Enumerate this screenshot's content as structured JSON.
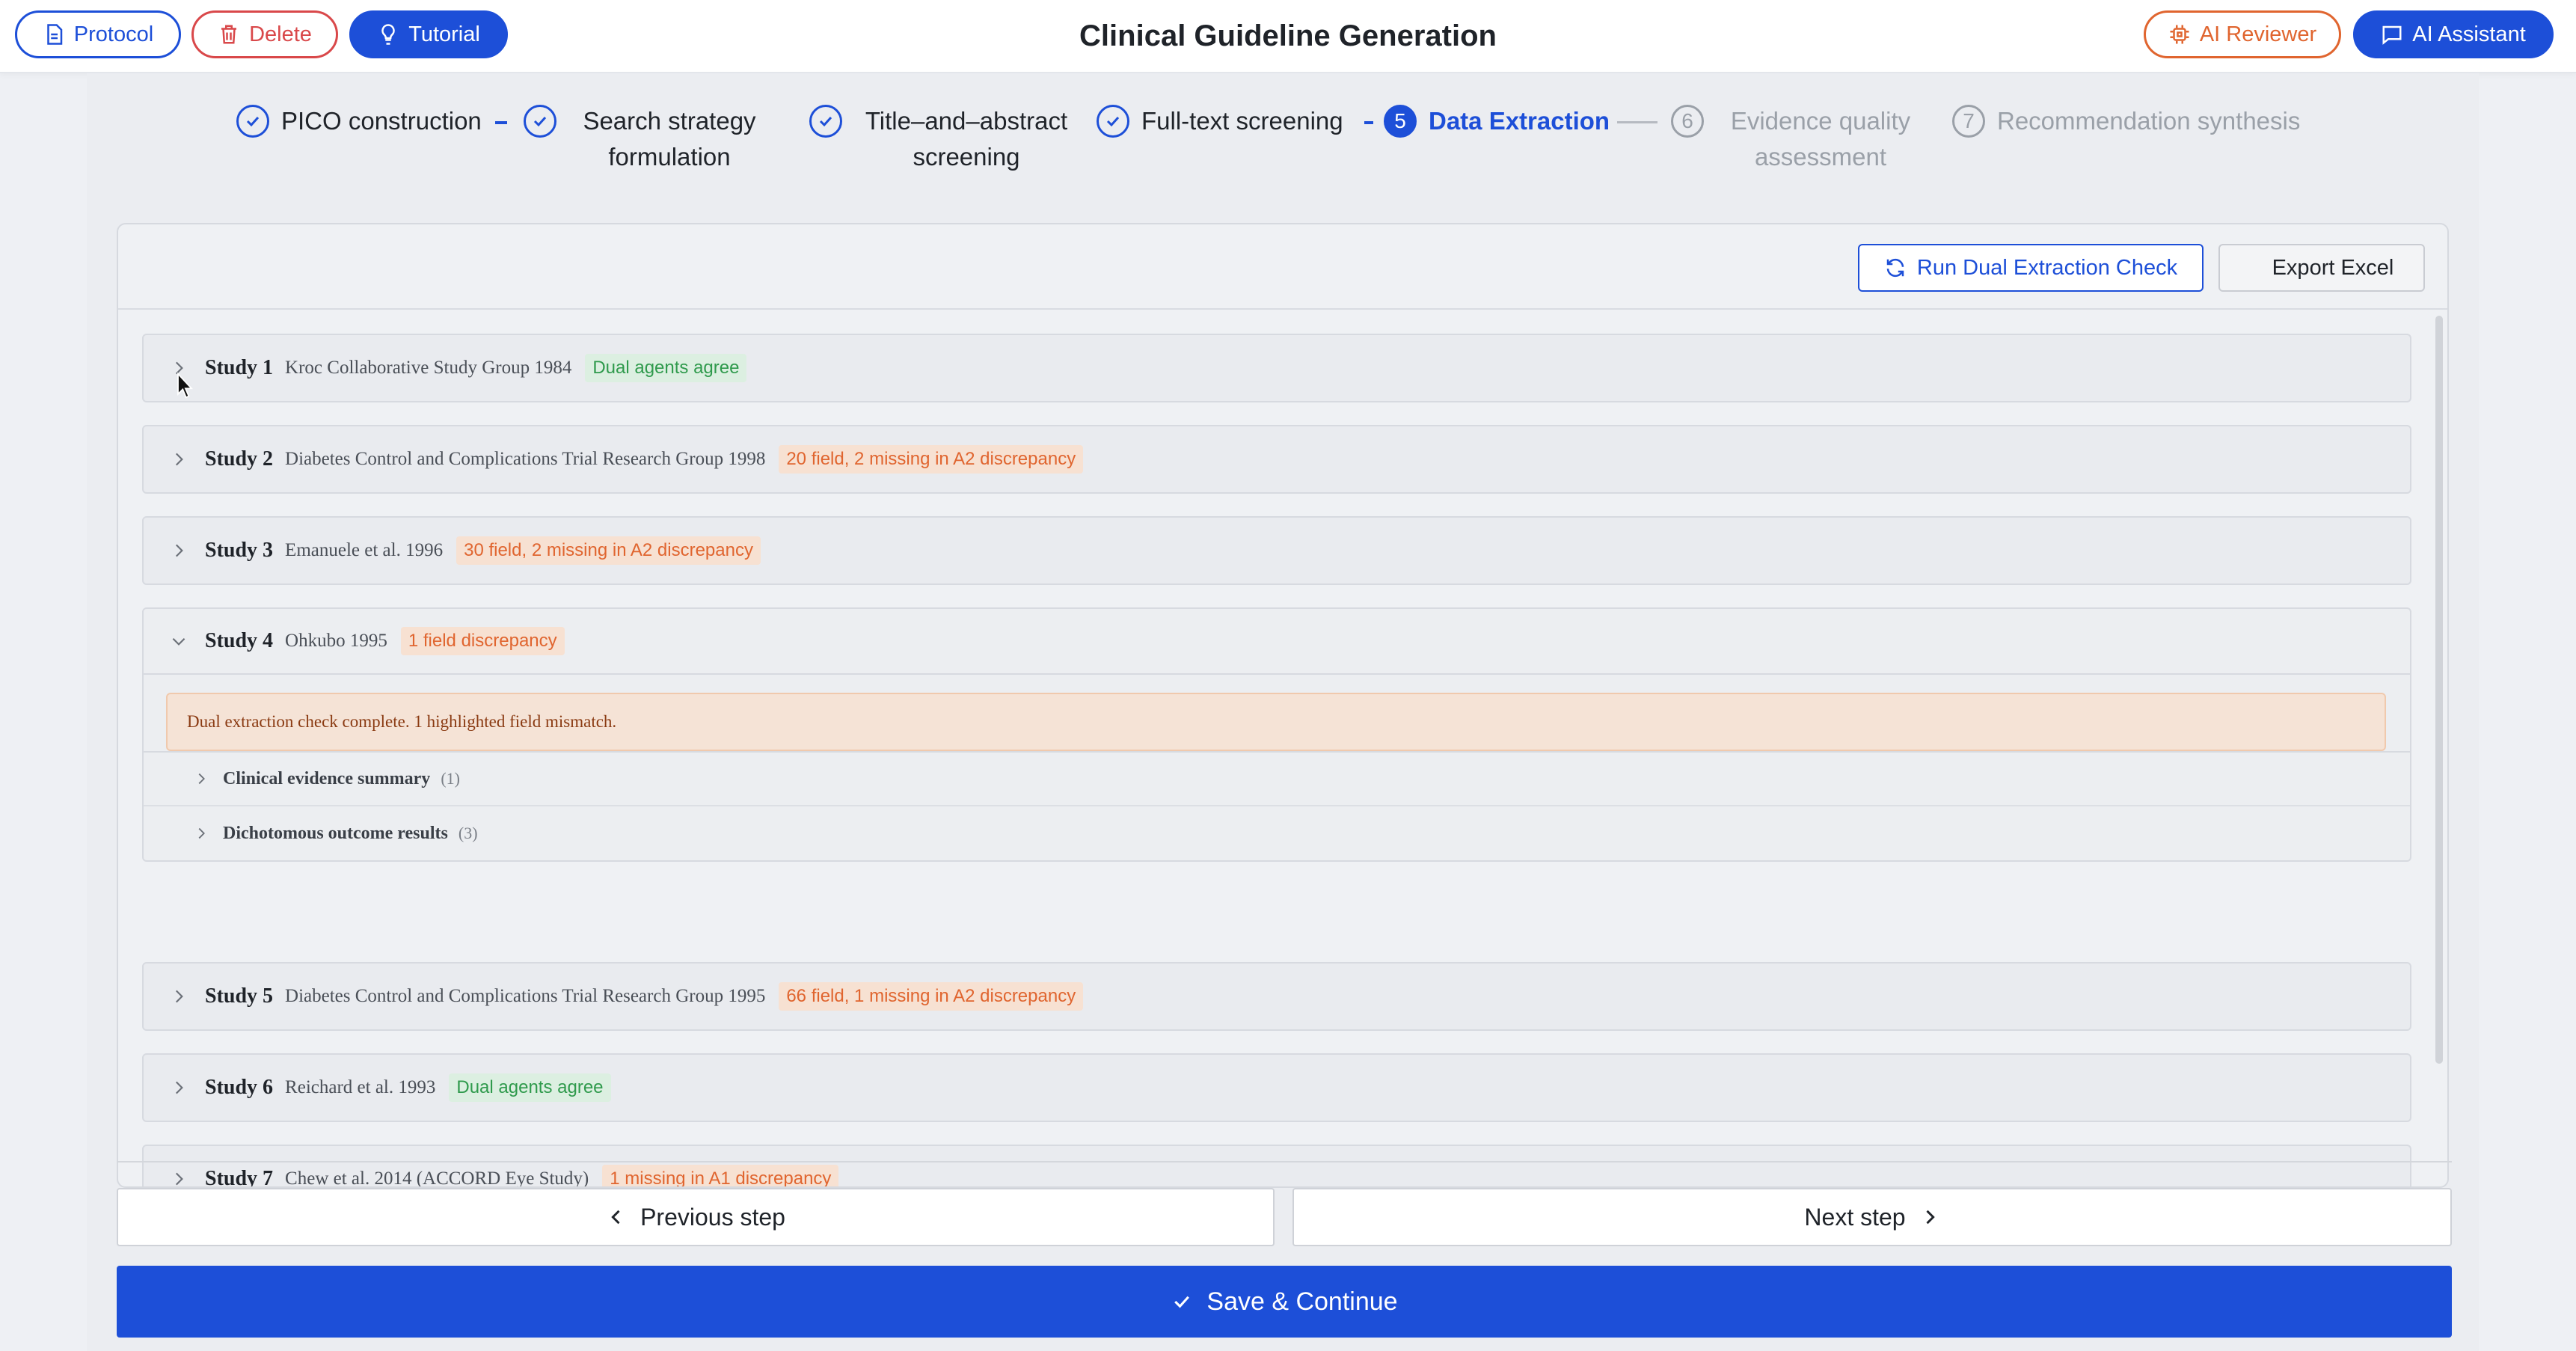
{
  "topbar": {
    "title": "Clinical Guideline Generation",
    "protocol_label": "Protocol",
    "delete_label": "Delete",
    "tutorial_label": "Tutorial",
    "reviewer_label": "AI Reviewer",
    "assistant_label": "AI Assistant"
  },
  "stepper": {
    "steps": [
      {
        "num": "1",
        "label": "PICO construction",
        "state": "done"
      },
      {
        "num": "2",
        "label": "Search strategy formulation",
        "state": "done"
      },
      {
        "num": "3",
        "label": "Title–and–abstract screening",
        "state": "done"
      },
      {
        "num": "4",
        "label": "Full-text screening",
        "state": "done"
      },
      {
        "num": "5",
        "label": "Data Extraction",
        "state": "active"
      },
      {
        "num": "6",
        "label": "Evidence quality assessment",
        "state": "pending"
      },
      {
        "num": "7",
        "label": "Recommendation synthesis",
        "state": "pending"
      }
    ]
  },
  "card": {
    "run_label": "Run Dual Extraction Check",
    "export_label": "Export Excel"
  },
  "studies": [
    {
      "name": "Study 1",
      "author": "Kroc Collaborative Study Group 1984",
      "badge": "Dual agents agree",
      "badge_type": "ok",
      "expanded": false
    },
    {
      "name": "Study 2",
      "author": "Diabetes Control and Complications Trial Research Group 1998",
      "badge": "20 field, 2 missing in A2 discrepancy",
      "badge_type": "warn",
      "expanded": false
    },
    {
      "name": "Study 3",
      "author": "Emanuele et al. 1996",
      "badge": "30 field, 2 missing in A2 discrepancy",
      "badge_type": "warn",
      "expanded": false
    },
    {
      "name": "Study 4",
      "author": "Ohkubo 1995",
      "badge": "1 field discrepancy",
      "badge_type": "warn",
      "expanded": true,
      "alert": "Dual extraction check complete. 1 highlighted field mismatch.",
      "sections": [
        {
          "title": "Clinical evidence summary",
          "count": "(1)"
        },
        {
          "title": "Dichotomous outcome results",
          "count": "(3)"
        }
      ]
    },
    {
      "name": "Study 5",
      "author": "Diabetes Control and Complications Trial Research Group 1995",
      "badge": "66 field, 1 missing in A2 discrepancy",
      "badge_type": "warn",
      "expanded": false
    },
    {
      "name": "Study 6",
      "author": "Reichard et al. 1993",
      "badge": "Dual agents agree",
      "badge_type": "ok",
      "expanded": false
    },
    {
      "name": "Study 7",
      "author": "Chew et al. 2014 (ACCORD Eye Study)",
      "badge": "1 missing in A1 discrepancy",
      "badge_type": "warn",
      "expanded": false
    }
  ],
  "nav": {
    "prev_label": "Previous step",
    "next_label": "Next step",
    "save_label": "Save & Continue"
  },
  "colors": {
    "primary": "#1d4fd8",
    "danger": "#d9484a",
    "warning": "#e0652f",
    "success": "#2f9a4c"
  }
}
